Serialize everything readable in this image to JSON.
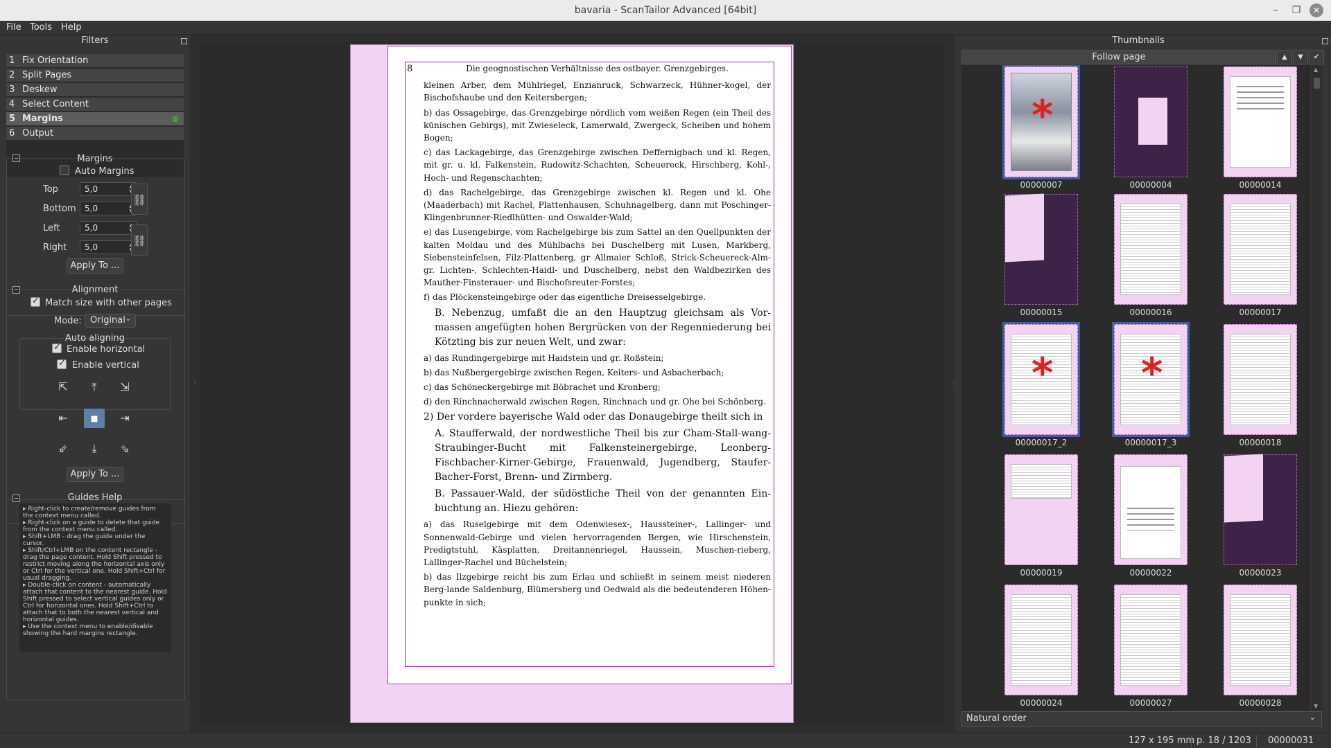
{
  "window": {
    "title": "bavaria - ScanTailor Advanced [64bit]"
  },
  "menu": [
    "File",
    "Tools",
    "Help"
  ],
  "filters": {
    "header": "Filters",
    "items": [
      {
        "num": "1",
        "label": "Fix Orientation"
      },
      {
        "num": "2",
        "label": "Split Pages"
      },
      {
        "num": "3",
        "label": "Deskew"
      },
      {
        "num": "4",
        "label": "Select Content"
      },
      {
        "num": "5",
        "label": "Margins"
      },
      {
        "num": "6",
        "label": "Output"
      }
    ],
    "selected_index": 4
  },
  "margins": {
    "title": "Margins",
    "auto_label": "Auto Margins",
    "auto_checked": false,
    "top_label": "Top",
    "top_value": "5,0",
    "bottom_label": "Bottom",
    "bottom_value": "5,0",
    "left_label": "Left",
    "left_value": "5,0",
    "right_label": "Right",
    "right_value": "5,0",
    "apply_label": "Apply To ..."
  },
  "alignment": {
    "title": "Alignment",
    "match_label": "Match size with other pages",
    "match_checked": true,
    "mode_label": "Mode:",
    "mode_value": "Original",
    "auto_title": "Auto aligning",
    "horiz_label": "Enable horizontal",
    "vert_label": "Enable vertical",
    "apply_label": "Apply To ..."
  },
  "guides_help": {
    "title": "Guides Help",
    "items": [
      "▸ Right-click to create/remove guides from the context menu called.",
      "▸ Right-click on a guide to delete that guide from the context menu called.",
      "▸ Shift+LMB - drag the guide under the cursor.",
      "▸ Shift/Ctrl+LMB on the content rectangle - drag the page content. Hold Shift pressed to restrict moving along the horizontal axis only or Ctrl for the vertical one. Hold Shift+Ctrl for usual dragging.",
      "▸ Double-click on content - automatically attach that content to the nearest guide. Hold Shift pressed to select vertical guides only or Ctrl for horizontal ones. Hold Shift+Ctrl to attach that to both the nearest vertical and horizontal guides.",
      "▸ Use the context menu to enable/disable showing the hard margins rectangle."
    ]
  },
  "page": {
    "number": "8",
    "header": "Die geognostischen Verhältnisse des ostbayer. Grenzgebirges.",
    "paragraphs": [
      "kleinen Arber, dem Mühlriegel, Enzianruck, Schwarzeck, Hühner-kogel, der Bischofshaube und den Keitersbergen;",
      "b) das Ossagebirge, das Grenzgebirge nördlich vom weißen Regen (ein Theil des künischen Gebirgs), mit Zwieseleck, Lamerwald, Zwergeck, Scheiben und hohem Bogen;",
      "c) das Lackagebirge, das Grenzgebirge zwischen Deffernigbach und kl. Regen, mit gr. u. kl. Falkenstein, Rudowitz-Schachten, Scheuereck, Hirschberg, Kohl-, Hoch- und Regenschachten;",
      "d) das Rachelgebirge, das Grenzgebirge zwischen kl. Regen und kl. Ohe (Maaderbach) mit Rachel, Plattenhausen, Schuhnagelberg, dann mit Poschinger-Klingenbrunner-Riedlhütten- und Oswalder-Wald;",
      "e) das Lusengebirge, vom Rachelgebirge bis zum Sattel an den Quellpunkten der kalten Moldau und des Mühlbachs bei Duschelberg mit Lusen, Markberg, Siebensteinfelsen, Filz-Plattenberg, gr Allmaier Schloß, Strick-Scheuereck-Alm-gr. Lichten-, Schlechten-Haidl- und Duschelberg, nebst den Waldbezirken des Mauther-Finsterauer- und Bischofsreuter-Forstes;",
      "f) das Plöckensteingebirge oder das eigentliche Dreisesselgebirge.",
      "B. Nebenzug, umfaßt die an den Hauptzug gleichsam als Vor-massen angefügten hohen Bergrücken von der Regenniederung bei Kötzting bis zur neuen Welt, und zwar:",
      "a) das Rundingergebirge mit Haidstein und gr. Roßstein;",
      "b) das Nußbergergebirge zwischen Regen, Keiters- und Asbacherbach;",
      "c) das Schöneckergebirge mit Böbrachet und Kronberg;",
      "d) den Rinchnacherwald zwischen Regen, Rinchnach und gr. Ohe bei Schönberg.",
      "2) Der vordere bayerische Wald oder das Donaugebirge theilt sich in",
      "A. Staufferwald, der nordwestliche Theil bis zur Cham-Stall-wang-Straubinger-Bucht mit Falkensteinergebirge, Leonberg-Fischbacher-Kirner-Gebirge, Frauenwald, Jugendberg, Staufer-Bacher-Forst, Brenn- und Zirmberg.",
      "B. Passauer-Wald, der südöstliche Theil von der genannten Ein-buchtung an. Hiezu gehören:",
      "a) das Ruselgebirge mit dem Odenwiesex-, Haussteiner-, Lallinger- und Sonnenwald-Gebirge und vielen hervorragenden Bergen, wie Hirschenstein, Predigtstuhl, Käsplatten, Dreitannenriegel, Haussein, Muschen-rieberg, Lallinger-Rachel und Büchelstein;",
      "b) das Ilzgebirge reicht bis zum Erlau und schließt in seinem meist niederen Berg-lande Saldenburg, Blümersberg und Oedwald als die bedeutenderen Höhen-punkte in sich;"
    ]
  },
  "thumbnails": {
    "header": "Thumbnails",
    "follow_label": "Follow page",
    "order_label": "Natural order",
    "items": [
      {
        "label": "00000007",
        "kind": "image",
        "selected": true,
        "asterisk": true
      },
      {
        "label": "00000004",
        "kind": "dark-small",
        "selected": false,
        "asterisk": false
      },
      {
        "label": "00000014",
        "kind": "title",
        "selected": false,
        "asterisk": false
      },
      {
        "label": "00000015",
        "kind": "dark-skew",
        "selected": false,
        "asterisk": false
      },
      {
        "label": "00000016",
        "kind": "text",
        "selected": false,
        "asterisk": false
      },
      {
        "label": "00000017",
        "kind": "text",
        "selected": false,
        "asterisk": false
      },
      {
        "label": "00000017_2",
        "kind": "text",
        "selected": true,
        "asterisk": true
      },
      {
        "label": "00000017_3",
        "kind": "text",
        "selected": true,
        "asterisk": true
      },
      {
        "label": "00000018",
        "kind": "text",
        "selected": false,
        "asterisk": false
      },
      {
        "label": "00000019",
        "kind": "text-top",
        "selected": false,
        "asterisk": false
      },
      {
        "label": "00000022",
        "kind": "chapter",
        "selected": false,
        "asterisk": false
      },
      {
        "label": "00000023",
        "kind": "dark-skew",
        "selected": false,
        "asterisk": false
      },
      {
        "label": "00000024",
        "kind": "text",
        "selected": false,
        "asterisk": false
      },
      {
        "label": "00000027",
        "kind": "text",
        "selected": false,
        "asterisk": false
      },
      {
        "label": "00000028",
        "kind": "text",
        "selected": false,
        "asterisk": false
      }
    ]
  },
  "status": {
    "size": "127 x 195 mm",
    "page": "p. 18 / 1203",
    "file": "00000031"
  },
  "colors": {
    "page_fill": "#f2d4f2",
    "content_border": "#a020c0",
    "selected_filter_dot": "#3aa03a",
    "thumb_selected": "#3a5fa8",
    "asterisk": "#e02020"
  }
}
